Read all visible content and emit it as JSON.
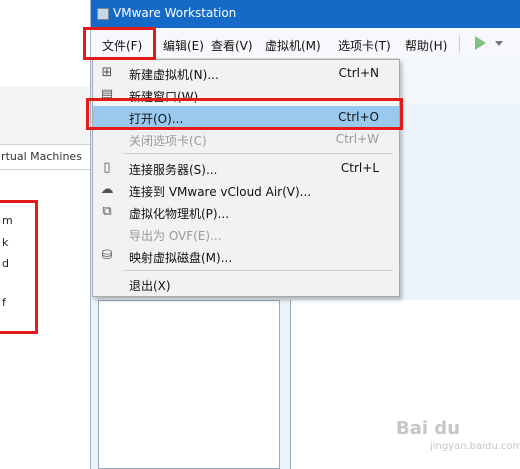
{
  "window": {
    "title": "VMware Workstation"
  },
  "menubar": {
    "items": [
      "文件(F)",
      "编辑(E)",
      "查看(V)",
      "虚拟机(M)",
      "选项卡(T)",
      "帮助(H)"
    ]
  },
  "left_window": {
    "tab_text": "irtual Machines",
    "fragments": [
      "m",
      "k",
      "d",
      "f"
    ]
  },
  "file_menu": {
    "items": [
      {
        "label": "新建虚拟机(N)...",
        "shortcut": "Ctrl+N",
        "icon": "new-vm-icon",
        "disabled": false,
        "highlighted": false
      },
      {
        "label": "新建窗口(W)",
        "shortcut": "",
        "icon": "new-window-icon",
        "disabled": false,
        "highlighted": false
      },
      {
        "label": "打开(O)...",
        "shortcut": "Ctrl+O",
        "icon": "",
        "disabled": false,
        "highlighted": true
      },
      {
        "label": "关闭选项卡(C)",
        "shortcut": "Ctrl+W",
        "icon": "",
        "disabled": true,
        "highlighted": false
      },
      {
        "label": "连接服务器(S)...",
        "shortcut": "Ctrl+L",
        "icon": "server-icon",
        "disabled": false,
        "highlighted": false
      },
      {
        "label": "连接到 VMware vCloud Air(V)...",
        "shortcut": "",
        "icon": "cloud-icon",
        "disabled": false,
        "highlighted": false
      },
      {
        "label": "虚拟化物理机(P)...",
        "shortcut": "",
        "icon": "physical-machine-icon",
        "disabled": false,
        "highlighted": false
      },
      {
        "label": "导出为 OVF(E)...",
        "shortcut": "",
        "icon": "",
        "disabled": true,
        "highlighted": false
      },
      {
        "label": "映射虚拟磁盘(M)...",
        "shortcut": "",
        "icon": "disk-icon",
        "disabled": false,
        "highlighted": false
      },
      {
        "label": "退出(X)",
        "shortcut": "",
        "icon": "",
        "disabled": false,
        "highlighted": false
      }
    ]
  },
  "watermark": {
    "text": "Bai du",
    "sub": "jingyan.baidu.com"
  },
  "colors": {
    "highlight": "#99c9ef",
    "annotation_red": "#e51b1b",
    "titlebar": "#1569c7"
  }
}
